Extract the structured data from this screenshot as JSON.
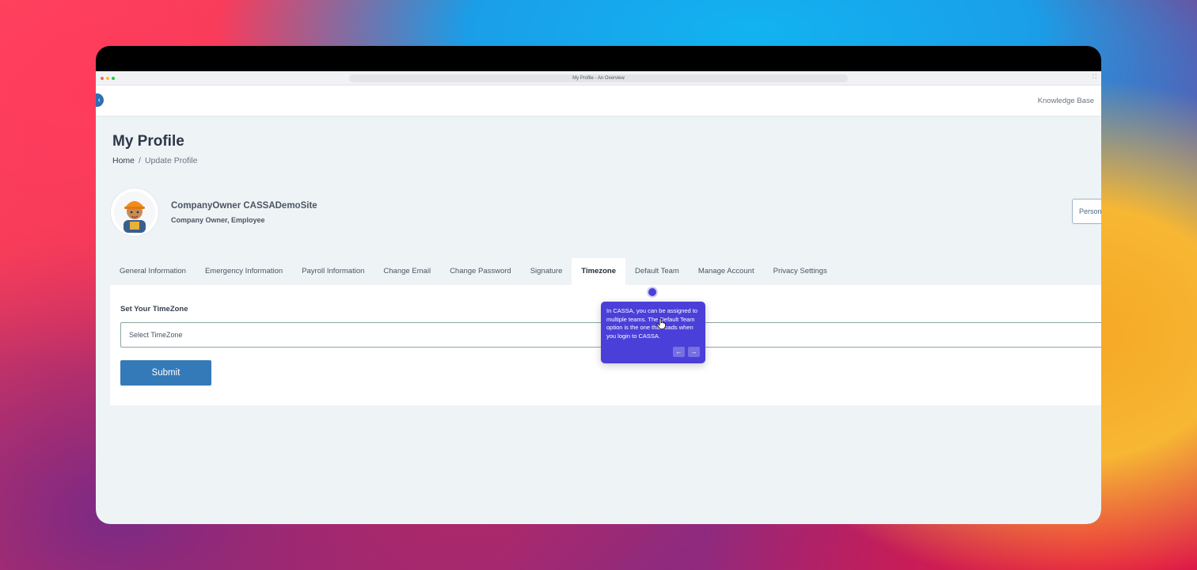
{
  "browser": {
    "tab_title": "My Profile - An Overview",
    "traffic_colors": [
      "#ff5f57",
      "#febc2e",
      "#28c840"
    ]
  },
  "topnav": {
    "back_icon": "chevron-left-icon",
    "knowledge_base": "Knowledge Base"
  },
  "page": {
    "title": "My Profile",
    "breadcrumb": {
      "home": "Home",
      "separator": "/",
      "current": "Update Profile"
    }
  },
  "user": {
    "name": "CompanyOwner CASSADemoSite",
    "roles": "Company Owner, Employee",
    "right_button_label": "Personal"
  },
  "tabs": [
    {
      "label": "General Information",
      "active": false
    },
    {
      "label": "Emergency Information",
      "active": false
    },
    {
      "label": "Payroll Information",
      "active": false
    },
    {
      "label": "Change Email",
      "active": false
    },
    {
      "label": "Change Password",
      "active": false
    },
    {
      "label": "Signature",
      "active": false
    },
    {
      "label": "Timezone",
      "active": true
    },
    {
      "label": "Default Team",
      "active": false
    },
    {
      "label": "Manage Account",
      "active": false
    },
    {
      "label": "Privacy Settings",
      "active": false
    }
  ],
  "form": {
    "label": "Set Your TimeZone",
    "select_placeholder": "Select TimeZone",
    "submit_label": "Submit"
  },
  "tooltip": {
    "text": "In CASSA, you can be assigned to multiple teams. The Default Team option is the one that loads when you login to CASSA.",
    "prev": "←",
    "next": "→",
    "accent": "#4a3fd9"
  },
  "colors": {
    "primary": "#357ab8",
    "back_button": "#2f6db4",
    "page_bg": "#eef3f6"
  }
}
